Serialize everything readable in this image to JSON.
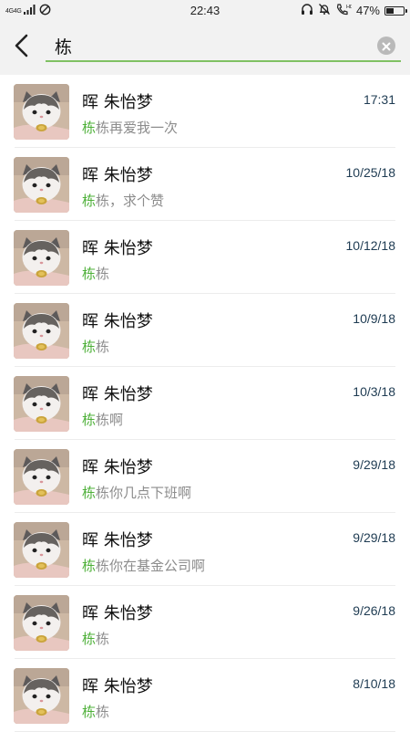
{
  "status_bar": {
    "network_label": "4G4G",
    "time": "22:43",
    "battery_percent_label": "47%",
    "battery_level": 0.47
  },
  "search": {
    "query": "栋",
    "placeholder": "",
    "accent_color": "#7fc163"
  },
  "colors": {
    "highlight": "#4db038",
    "snippet": "#8c8c8c",
    "time": "#1e3b52"
  },
  "results": [
    {
      "name": "晖 朱怡梦",
      "time": "17:31",
      "highlight": "栋",
      "rest": "栋再爱我一次"
    },
    {
      "name": "晖 朱怡梦",
      "time": "10/25/18",
      "highlight": "栋",
      "rest": "栋，求个赞"
    },
    {
      "name": "晖 朱怡梦",
      "time": "10/12/18",
      "highlight": "栋",
      "rest": "栋"
    },
    {
      "name": "晖 朱怡梦",
      "time": "10/9/18",
      "highlight": "栋",
      "rest": "栋"
    },
    {
      "name": "晖 朱怡梦",
      "time": "10/3/18",
      "highlight": "栋",
      "rest": "栋啊"
    },
    {
      "name": "晖 朱怡梦",
      "time": "9/29/18",
      "highlight": "栋",
      "rest": "栋你几点下班啊"
    },
    {
      "name": "晖 朱怡梦",
      "time": "9/29/18",
      "highlight": "栋",
      "rest": "栋你在基金公司啊"
    },
    {
      "name": "晖 朱怡梦",
      "time": "9/26/18",
      "highlight": "栋",
      "rest": "栋"
    },
    {
      "name": "晖 朱怡梦",
      "time": "8/10/18",
      "highlight": "栋",
      "rest": "栋"
    }
  ],
  "icons": {
    "back": "chevron-left-icon",
    "clear": "clear-circle-icon",
    "avatar": "cat-photo-avatar"
  }
}
